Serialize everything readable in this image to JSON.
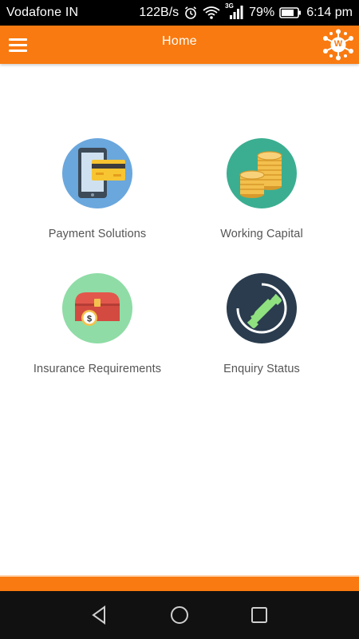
{
  "status_bar": {
    "carrier": "Vodafone IN",
    "net_speed": "122B/s",
    "network_type": "3G",
    "battery_percent": "79%",
    "battery_level": 0.79,
    "time": "6:14 pm"
  },
  "app_bar": {
    "title": "Home",
    "logo_letter": "W",
    "color": "#f97a10"
  },
  "tiles": [
    {
      "label": "Payment Solutions",
      "icon": "payment-icon",
      "bg": "#6aa7dd"
    },
    {
      "label": "Working Capital",
      "icon": "coins-icon",
      "bg": "#3bae91"
    },
    {
      "label": "Insurance Requirements",
      "icon": "chest-icon",
      "bg": "#8fdca6"
    },
    {
      "label": "Enquiry Status",
      "icon": "phone-icon",
      "bg": "#2a3c4e"
    }
  ],
  "nav": {
    "back_icon": "back-triangle-icon",
    "home_icon": "home-circle-icon",
    "recents_icon": "recents-square-icon"
  }
}
